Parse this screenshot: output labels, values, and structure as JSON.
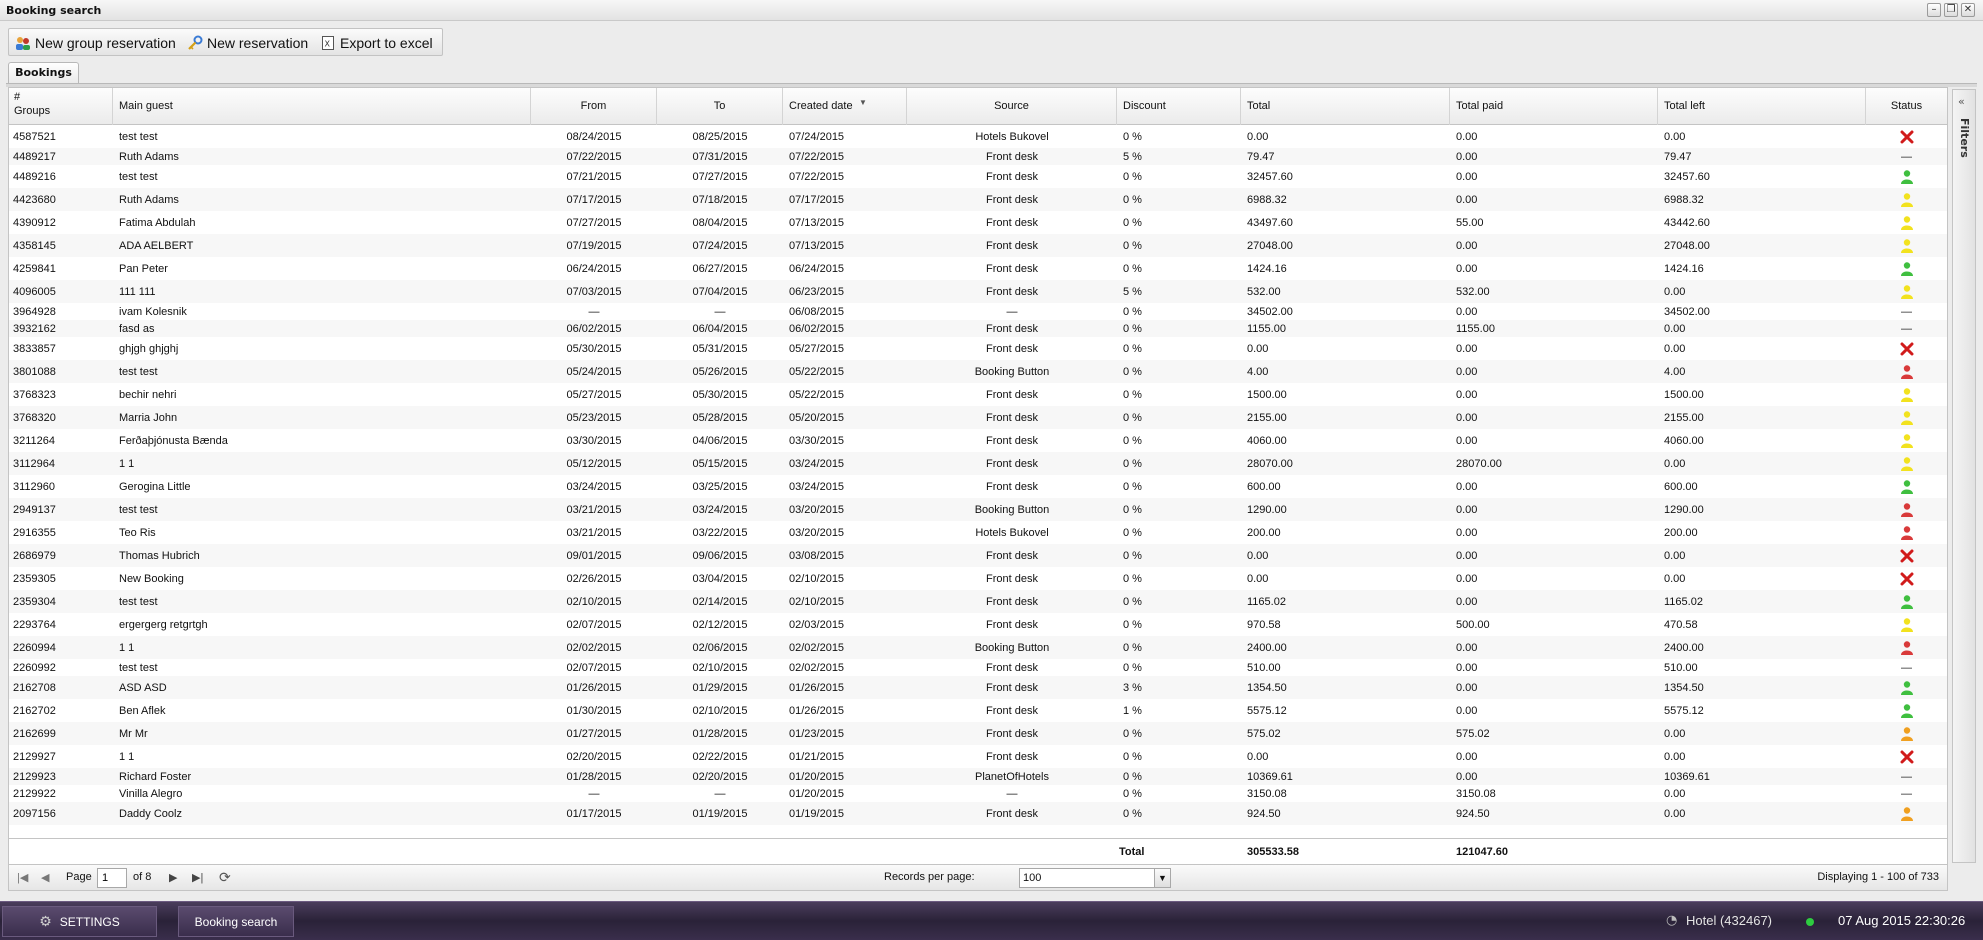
{
  "window": {
    "title": "Booking search"
  },
  "toolbar": {
    "new_group": "New group reservation",
    "new_reservation": "New reservation",
    "export": "Export to excel"
  },
  "tabs": [
    {
      "label": "Bookings"
    }
  ],
  "columns": {
    "id_top": "#",
    "id_bottom": "Groups",
    "guest": "Main guest",
    "from": "From",
    "to": "To",
    "created": "Created date",
    "source": "Source",
    "discount": "Discount",
    "total": "Total",
    "paid": "Total paid",
    "left": "Total left",
    "status": "Status"
  },
  "rows": [
    {
      "id": "4587521",
      "guest": "test test",
      "from": "08/24/2015",
      "to": "08/25/2015",
      "created": "07/24/2015",
      "source": "Hotels Bukovel",
      "discount": "0 %",
      "total": "0.00",
      "paid": "0.00",
      "left": "0.00",
      "status": "cancelled"
    },
    {
      "id": "4489217",
      "guest": "Ruth Adams",
      "from": "07/22/2015",
      "to": "07/31/2015",
      "created": "07/22/2015",
      "source": "Front desk",
      "discount": "5 %",
      "total": "79.47",
      "paid": "0.00",
      "left": "79.47",
      "status": "none"
    },
    {
      "id": "4489216",
      "guest": "test test",
      "from": "07/21/2015",
      "to": "07/27/2015",
      "created": "07/22/2015",
      "source": "Front desk",
      "discount": "0 %",
      "total": "32457.60",
      "paid": "0.00",
      "left": "32457.60",
      "status": "green"
    },
    {
      "id": "4423680",
      "guest": "Ruth Adams",
      "from": "07/17/2015",
      "to": "07/18/2015",
      "created": "07/17/2015",
      "source": "Front desk",
      "discount": "0 %",
      "total": "6988.32",
      "paid": "0.00",
      "left": "6988.32",
      "status": "yellow"
    },
    {
      "id": "4390912",
      "guest": "Fatima Abdulah",
      "from": "07/27/2015",
      "to": "08/04/2015",
      "created": "07/13/2015",
      "source": "Front desk",
      "discount": "0 %",
      "total": "43497.60",
      "paid": "55.00",
      "left": "43442.60",
      "status": "yellow"
    },
    {
      "id": "4358145",
      "guest": "ADA AELBERT",
      "from": "07/19/2015",
      "to": "07/24/2015",
      "created": "07/13/2015",
      "source": "Front desk",
      "discount": "0 %",
      "total": "27048.00",
      "paid": "0.00",
      "left": "27048.00",
      "status": "yellow"
    },
    {
      "id": "4259841",
      "guest": "Pan Peter",
      "from": "06/24/2015",
      "to": "06/27/2015",
      "created": "06/24/2015",
      "source": "Front desk",
      "discount": "0 %",
      "total": "1424.16",
      "paid": "0.00",
      "left": "1424.16",
      "status": "green"
    },
    {
      "id": "4096005",
      "guest": "111 111",
      "from": "07/03/2015",
      "to": "07/04/2015",
      "created": "06/23/2015",
      "source": "Front desk",
      "discount": "5 %",
      "total": "532.00",
      "paid": "532.00",
      "left": "0.00",
      "status": "yellow"
    },
    {
      "id": "3964928",
      "guest": "ivam Kolesnik",
      "from": "—",
      "to": "—",
      "created": "06/08/2015",
      "source": "—",
      "discount": "0 %",
      "total": "34502.00",
      "paid": "0.00",
      "left": "34502.00",
      "status": "none"
    },
    {
      "id": "3932162",
      "guest": "fasd as",
      "from": "06/02/2015",
      "to": "06/04/2015",
      "created": "06/02/2015",
      "source": "Front desk",
      "discount": "0 %",
      "total": "1155.00",
      "paid": "1155.00",
      "left": "0.00",
      "status": "none"
    },
    {
      "id": "3833857",
      "guest": "ghjgh ghjghj",
      "from": "05/30/2015",
      "to": "05/31/2015",
      "created": "05/27/2015",
      "source": "Front desk",
      "discount": "0 %",
      "total": "0.00",
      "paid": "0.00",
      "left": "0.00",
      "status": "cancelled"
    },
    {
      "id": "3801088",
      "guest": "test test",
      "from": "05/24/2015",
      "to": "05/26/2015",
      "created": "05/22/2015",
      "source": "Booking Button",
      "discount": "0 %",
      "total": "4.00",
      "paid": "0.00",
      "left": "4.00",
      "status": "red"
    },
    {
      "id": "3768323",
      "guest": "bechir nehri",
      "from": "05/27/2015",
      "to": "05/30/2015",
      "created": "05/22/2015",
      "source": "Front desk",
      "discount": "0 %",
      "total": "1500.00",
      "paid": "0.00",
      "left": "1500.00",
      "status": "yellow"
    },
    {
      "id": "3768320",
      "guest": "Marria John",
      "from": "05/23/2015",
      "to": "05/28/2015",
      "created": "05/20/2015",
      "source": "Front desk",
      "discount": "0 %",
      "total": "2155.00",
      "paid": "0.00",
      "left": "2155.00",
      "status": "yellow"
    },
    {
      "id": "3211264",
      "guest": "Ferðaþjónusta Bænda",
      "from": "03/30/2015",
      "to": "04/06/2015",
      "created": "03/30/2015",
      "source": "Front desk",
      "discount": "0 %",
      "total": "4060.00",
      "paid": "0.00",
      "left": "4060.00",
      "status": "yellow"
    },
    {
      "id": "3112964",
      "guest": "1 1",
      "from": "05/12/2015",
      "to": "05/15/2015",
      "created": "03/24/2015",
      "source": "Front desk",
      "discount": "0 %",
      "total": "28070.00",
      "paid": "28070.00",
      "left": "0.00",
      "status": "yellow"
    },
    {
      "id": "3112960",
      "guest": "Gerogina Little",
      "from": "03/24/2015",
      "to": "03/25/2015",
      "created": "03/24/2015",
      "source": "Front desk",
      "discount": "0 %",
      "total": "600.00",
      "paid": "0.00",
      "left": "600.00",
      "status": "green"
    },
    {
      "id": "2949137",
      "guest": "test test",
      "from": "03/21/2015",
      "to": "03/24/2015",
      "created": "03/20/2015",
      "source": "Booking Button",
      "discount": "0 %",
      "total": "1290.00",
      "paid": "0.00",
      "left": "1290.00",
      "status": "red"
    },
    {
      "id": "2916355",
      "guest": "Teo Ris",
      "from": "03/21/2015",
      "to": "03/22/2015",
      "created": "03/20/2015",
      "source": "Hotels Bukovel",
      "discount": "0 %",
      "total": "200.00",
      "paid": "0.00",
      "left": "200.00",
      "status": "red"
    },
    {
      "id": "2686979",
      "guest": "Thomas Hubrich",
      "from": "09/01/2015",
      "to": "09/06/2015",
      "created": "03/08/2015",
      "source": "Front desk",
      "discount": "0 %",
      "total": "0.00",
      "paid": "0.00",
      "left": "0.00",
      "status": "cancelled"
    },
    {
      "id": "2359305",
      "guest": "New Booking",
      "from": "02/26/2015",
      "to": "03/04/2015",
      "created": "02/10/2015",
      "source": "Front desk",
      "discount": "0 %",
      "total": "0.00",
      "paid": "0.00",
      "left": "0.00",
      "status": "cancelled"
    },
    {
      "id": "2359304",
      "guest": "test test",
      "from": "02/10/2015",
      "to": "02/14/2015",
      "created": "02/10/2015",
      "source": "Front desk",
      "discount": "0 %",
      "total": "1165.02",
      "paid": "0.00",
      "left": "1165.02",
      "status": "green"
    },
    {
      "id": "2293764",
      "guest": "ergergerg retgrtgh",
      "from": "02/07/2015",
      "to": "02/12/2015",
      "created": "02/03/2015",
      "source": "Front desk",
      "discount": "0 %",
      "total": "970.58",
      "paid": "500.00",
      "left": "470.58",
      "status": "yellow"
    },
    {
      "id": "2260994",
      "guest": "1 1",
      "from": "02/02/2015",
      "to": "02/06/2015",
      "created": "02/02/2015",
      "source": "Booking Button",
      "discount": "0 %",
      "total": "2400.00",
      "paid": "0.00",
      "left": "2400.00",
      "status": "red"
    },
    {
      "id": "2260992",
      "guest": "test test",
      "from": "02/07/2015",
      "to": "02/10/2015",
      "created": "02/02/2015",
      "source": "Front desk",
      "discount": "0 %",
      "total": "510.00",
      "paid": "0.00",
      "left": "510.00",
      "status": "none"
    },
    {
      "id": "2162708",
      "guest": "ASD ASD",
      "from": "01/26/2015",
      "to": "01/29/2015",
      "created": "01/26/2015",
      "source": "Front desk",
      "discount": "3 %",
      "total": "1354.50",
      "paid": "0.00",
      "left": "1354.50",
      "status": "green"
    },
    {
      "id": "2162702",
      "guest": "Ben Aflek",
      "from": "01/30/2015",
      "to": "02/10/2015",
      "created": "01/26/2015",
      "source": "Front desk",
      "discount": "1 %",
      "total": "5575.12",
      "paid": "0.00",
      "left": "5575.12",
      "status": "green"
    },
    {
      "id": "2162699",
      "guest": "Mr Mr",
      "from": "01/27/2015",
      "to": "01/28/2015",
      "created": "01/23/2015",
      "source": "Front desk",
      "discount": "0 %",
      "total": "575.02",
      "paid": "575.02",
      "left": "0.00",
      "status": "orange"
    },
    {
      "id": "2129927",
      "guest": "1 1",
      "from": "02/20/2015",
      "to": "02/22/2015",
      "created": "01/21/2015",
      "source": "Front desk",
      "discount": "0 %",
      "total": "0.00",
      "paid": "0.00",
      "left": "0.00",
      "status": "cancelled"
    },
    {
      "id": "2129923",
      "guest": "Richard Foster",
      "from": "01/28/2015",
      "to": "02/20/2015",
      "created": "01/20/2015",
      "source": "PlanetOfHotels",
      "discount": "0 %",
      "total": "10369.61",
      "paid": "0.00",
      "left": "10369.61",
      "status": "none"
    },
    {
      "id": "2129922",
      "guest": "Vinilla Alegro",
      "from": "—",
      "to": "—",
      "created": "01/20/2015",
      "source": "—",
      "discount": "0 %",
      "total": "3150.08",
      "paid": "3150.08",
      "left": "0.00",
      "status": "none"
    },
    {
      "id": "2097156",
      "guest": "Daddy Coolz",
      "from": "01/17/2015",
      "to": "01/19/2015",
      "created": "01/19/2015",
      "source": "Front desk",
      "discount": "0 %",
      "total": "924.50",
      "paid": "924.50",
      "left": "0.00",
      "status": "orange"
    }
  ],
  "totals": {
    "label": "Total",
    "total": "305533.58",
    "paid": "121047.60"
  },
  "pager": {
    "page_label": "Page",
    "page_value": "1",
    "of_label": "of 8",
    "rpp_label": "Records per page:",
    "rpp_value": "100",
    "displaying": "Displaying 1 - 100 of 733"
  },
  "filters": {
    "label": "Filters"
  },
  "taskbar": {
    "settings": "SETTINGS",
    "booking_search": "Booking search",
    "hotel": "Hotel (432467)",
    "clock": "07 Aug 2015 22:30:26"
  },
  "colors": {
    "green": "#3fbf3f",
    "yellow": "#f2e21e",
    "red": "#d93a3a",
    "orange": "#f0a020",
    "cancelled": "#d11b1b",
    "taskbar": "#2a2238"
  }
}
